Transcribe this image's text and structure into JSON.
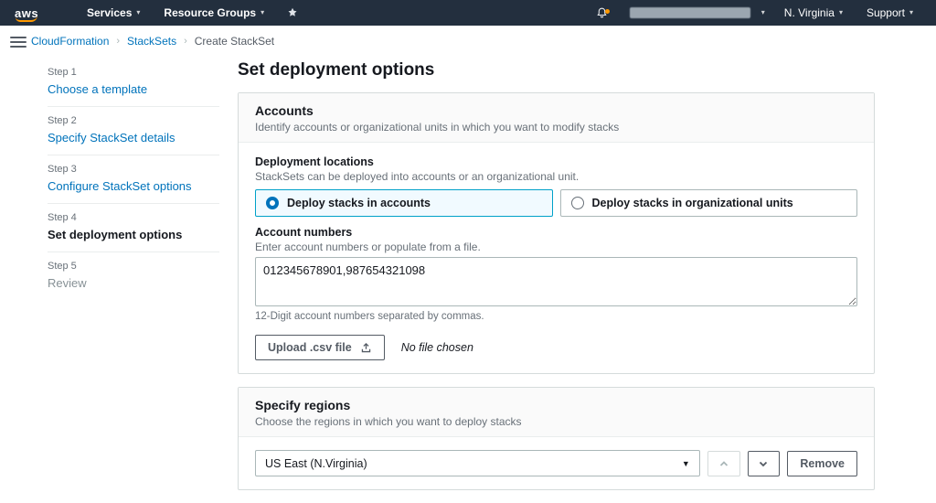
{
  "topnav": {
    "logo": "aws",
    "services": "Services",
    "resource_groups": "Resource Groups",
    "region": "N. Virginia",
    "support": "Support"
  },
  "breadcrumb": {
    "items": [
      {
        "label": "CloudFormation"
      },
      {
        "label": "StackSets"
      },
      {
        "label": "Create StackSet"
      }
    ]
  },
  "steps": [
    {
      "step": "Step 1",
      "label": "Choose a template"
    },
    {
      "step": "Step 2",
      "label": "Specify StackSet details"
    },
    {
      "step": "Step 3",
      "label": "Configure StackSet options"
    },
    {
      "step": "Step 4",
      "label": "Set deployment options"
    },
    {
      "step": "Step 5",
      "label": "Review"
    }
  ],
  "page": {
    "title": "Set deployment options"
  },
  "accounts_card": {
    "title": "Accounts",
    "subtitle": "Identify accounts or organizational units in which you want to modify stacks",
    "deployment_locations": {
      "label": "Deployment locations",
      "description": "StackSets can be deployed into accounts or an organizational unit.",
      "options": [
        {
          "label": "Deploy stacks in accounts",
          "selected": true
        },
        {
          "label": "Deploy stacks in organizational units",
          "selected": false
        }
      ]
    },
    "account_numbers": {
      "label": "Account numbers",
      "description": "Enter account numbers or populate from a file.",
      "value": "012345678901,987654321098",
      "hint": "12-Digit account numbers separated by commas."
    },
    "upload": {
      "button_label": "Upload .csv file",
      "no_file_text": "No file chosen"
    }
  },
  "regions_card": {
    "title": "Specify regions",
    "subtitle": "Choose the regions in which you want to deploy stacks",
    "region_row": {
      "selected_region": "US East (N.Virginia)",
      "remove_label": "Remove"
    }
  },
  "icons": {
    "chevron_down": "▾",
    "select_caret": "▼",
    "breadcrumb_separator": "›"
  },
  "colors": {
    "navbar": "#232f3e",
    "accent_orange": "#ff9900",
    "link": "#0073bb",
    "selected_tile_border": "#00a1c9",
    "selected_tile_bg": "#f1faff"
  }
}
